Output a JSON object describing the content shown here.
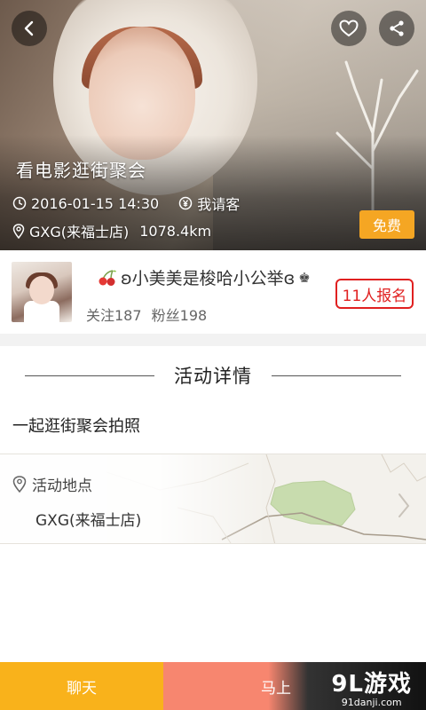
{
  "hero": {
    "title": "看电影逛街聚会",
    "datetime": "2016-01-15 14:30",
    "payment": "我请客",
    "venue": "GXG(来福士店)",
    "distance": "1078.4km",
    "price_badge": "免费"
  },
  "host": {
    "name": "ʚ小美美是梭哈小公举ɞ",
    "following": "关注187",
    "fans": "粉丝198",
    "signup_count": "11人报名"
  },
  "details": {
    "section_title": "活动详情",
    "description": "一起逛街聚会拍照",
    "location_label": "活动地点",
    "location_address": "GXG(来福士店)"
  },
  "bottom_bar": {
    "chat_label": "聊天",
    "join_label": "马上",
    "watermark_brand": "9L游戏",
    "watermark_site": "91danji.com"
  },
  "icons": {
    "back": "back-arrow-icon",
    "favorite": "heart-icon",
    "share": "share-icon",
    "time": "clock-icon",
    "payment": "yuan-icon",
    "location": "location-pin-icon"
  },
  "colors": {
    "accent_orange": "#F5A623",
    "chat_button": "#F9B21B",
    "join_button": "#F7866F",
    "signup_red": "#E02020"
  }
}
